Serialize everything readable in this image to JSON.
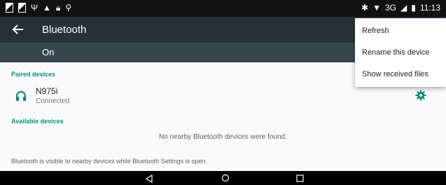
{
  "status_bar": {
    "left_icons": [
      "image-icon",
      "image-icon",
      "usb-icon",
      "warning-icon",
      "lock-icon",
      "pin-icon"
    ],
    "right_icons": [
      "bluetooth-icon",
      "wifi-icon"
    ],
    "network": "3G",
    "time": "11:13"
  },
  "toolbar": {
    "title": "Bluetooth"
  },
  "switch_bar": {
    "label": "On"
  },
  "paired": {
    "header": "Paired devices",
    "devices": [
      {
        "name": "N975i",
        "status": "Connected",
        "icon": "headset-icon"
      }
    ]
  },
  "available": {
    "header": "Available devices",
    "empty_message": "No nearby Bluetooth devices were found."
  },
  "footer_note": "Bluetooth is visible to nearby devices while Bluetooth Settings is open.",
  "overflow_menu": {
    "items": [
      "Refresh",
      "Rename this device",
      "Show received files"
    ]
  },
  "colors": {
    "toolbar": "#263238",
    "switch_bar": "#37474f",
    "accent": "#009688"
  }
}
